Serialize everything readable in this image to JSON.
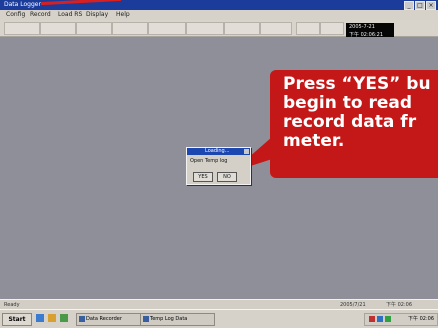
{
  "window": {
    "title": "Data Logger"
  },
  "menu": [
    {
      "label": "Config"
    },
    {
      "label": "Record"
    },
    {
      "label": "Load RS"
    },
    {
      "label": "Display"
    },
    {
      "label": "Help"
    }
  ],
  "clock_box": {
    "line1": "2005-7-21",
    "line2": "下午 02:06:21"
  },
  "dialog": {
    "title": "Loading...",
    "message": "Open Temp log",
    "yes_label": "YES",
    "no_label": "NO"
  },
  "callout": {
    "text": "Press “YES” bu\nbegin to read\nrecord data fr\nmeter.",
    "color": "#c41818"
  },
  "statusbar": {
    "left": "Ready",
    "date": "2005/7/21",
    "time": "下午 02:06"
  },
  "taskbar": {
    "start_label": "Start",
    "tasks": [
      {
        "label": "Data Recorder"
      },
      {
        "label": "Temp Log Data"
      }
    ],
    "tray_time": "下午 02:06"
  }
}
